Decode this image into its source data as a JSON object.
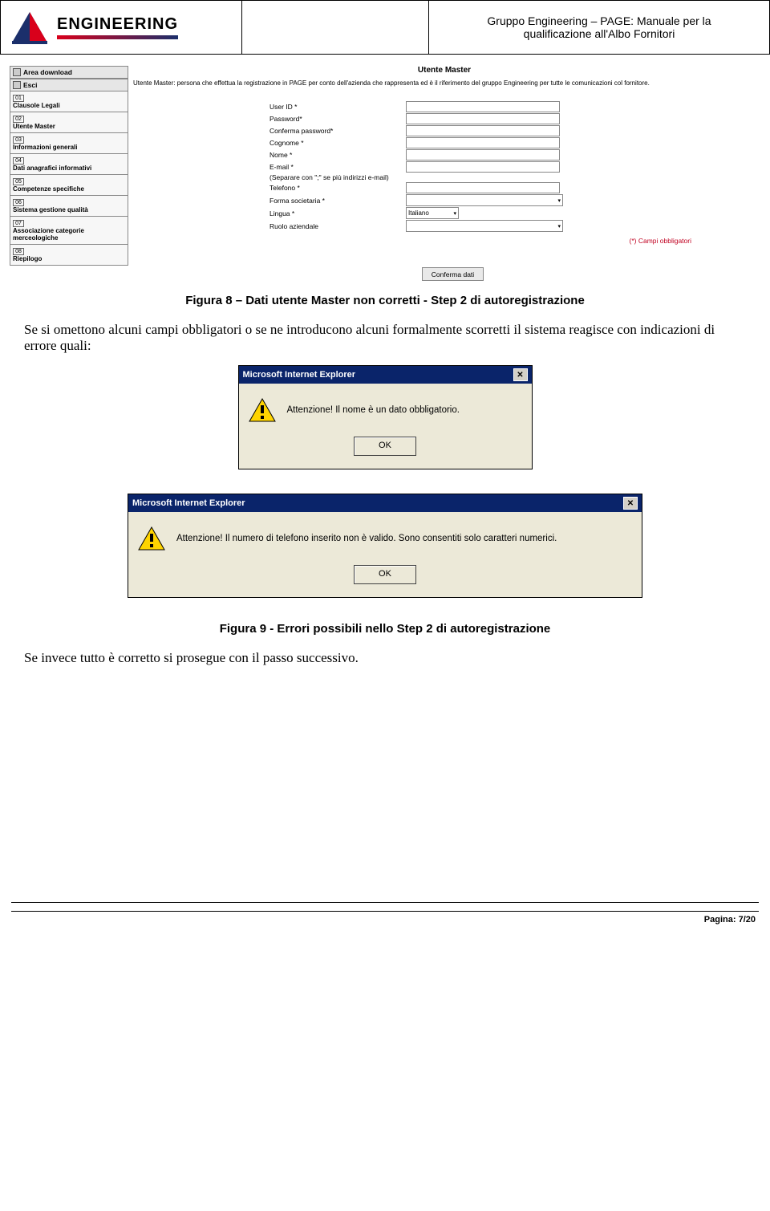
{
  "header": {
    "brand": "ENGINEERING",
    "doc_title_1": "Gruppo Engineering – PAGE: Manuale per la",
    "doc_title_2": "qualificazione all'Albo Fornitori"
  },
  "screenshot1": {
    "side_download": "Area download",
    "side_esci": "Esci",
    "steps": [
      {
        "n": "01",
        "t": "Clausole Legali"
      },
      {
        "n": "02",
        "t": "Utente Master"
      },
      {
        "n": "03",
        "t": "Informazioni generali"
      },
      {
        "n": "04",
        "t": "Dati anagrafici informativi"
      },
      {
        "n": "05",
        "t": "Competenze specifiche"
      },
      {
        "n": "06",
        "t": "Sistema gestione qualità"
      },
      {
        "n": "07",
        "t": "Associazione categorie merceologiche"
      },
      {
        "n": "08",
        "t": "Riepilogo"
      }
    ],
    "main_title": "Utente Master",
    "main_desc": "Utente Master: persona che effettua la registrazione in PAGE per conto dell'azienda che rappresenta ed è il riferimento del gruppo Engineering per tutte le comunicazioni col fornitore.",
    "fields": {
      "userid": "User ID *",
      "password": "Password*",
      "conferma": "Conferma password*",
      "cognome": "Cognome *",
      "nome": "Nome *",
      "email": "E-mail *",
      "email_hint": "(Separare con \";\" se più indirizzi e-mail)",
      "telefono": "Telefono *",
      "forma": "Forma societaria *",
      "lingua": "Lingua *",
      "lingua_val": "Italiano",
      "ruolo": "Ruolo aziendale"
    },
    "obbligatori": "(*) Campi obbligatori",
    "conferma_btn": "Conferma dati"
  },
  "caption8": "Figura 8 – Dati utente Master non corretti - Step 2 di autoregistrazione",
  "para1": "Se si omettono alcuni campi obbligatori o se ne introducono alcuni formalmente scorretti il sistema reagisce con indicazioni di errore quali:",
  "alert1": {
    "title": "Microsoft Internet Explorer",
    "msg": "Attenzione! Il nome è un dato obbligatorio.",
    "ok": "OK"
  },
  "alert2": {
    "title": "Microsoft Internet Explorer",
    "msg": "Attenzione! Il numero di telefono inserito non è valido. Sono consentiti solo caratteri numerici.",
    "ok": "OK"
  },
  "caption9": "Figura 9 - Errori possibili nello Step 2 di autoregistrazione",
  "para2": "Se invece tutto è corretto si prosegue con il passo successivo.",
  "footer": {
    "pagina": "Pagina: 7/20"
  }
}
